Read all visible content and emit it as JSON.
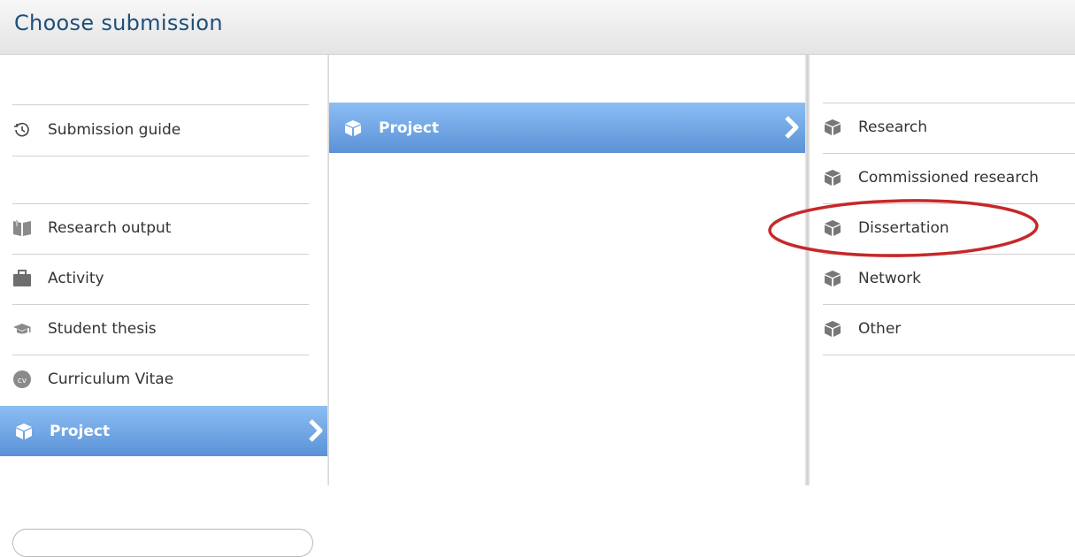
{
  "window": {
    "title": "Choose submission"
  },
  "left_panel": {
    "guide_label": "Submission guide",
    "items": [
      {
        "label": "Research output",
        "icon": "book-icon"
      },
      {
        "label": "Activity",
        "icon": "briefcase-icon"
      },
      {
        "label": "Student thesis",
        "icon": "graduation-cap-icon"
      },
      {
        "label": "Curriculum Vitae",
        "icon": "cv-icon"
      }
    ],
    "selected": {
      "label": "Project",
      "icon": "cube-icon"
    }
  },
  "middle_panel": {
    "selected": {
      "label": "Project",
      "icon": "cube-icon"
    }
  },
  "right_panel": {
    "items": [
      {
        "label": "Research",
        "icon": "cube-icon"
      },
      {
        "label": "Commissioned research",
        "icon": "cube-icon"
      },
      {
        "label": "Dissertation",
        "icon": "cube-icon",
        "highlighted": true
      },
      {
        "label": "Network",
        "icon": "cube-icon"
      },
      {
        "label": "Other",
        "icon": "cube-icon"
      }
    ]
  },
  "colors": {
    "title": "#1e4f7a",
    "selected_top": "#8cbef4",
    "selected_bottom": "#5b92d6",
    "annotation": "#c62828"
  }
}
